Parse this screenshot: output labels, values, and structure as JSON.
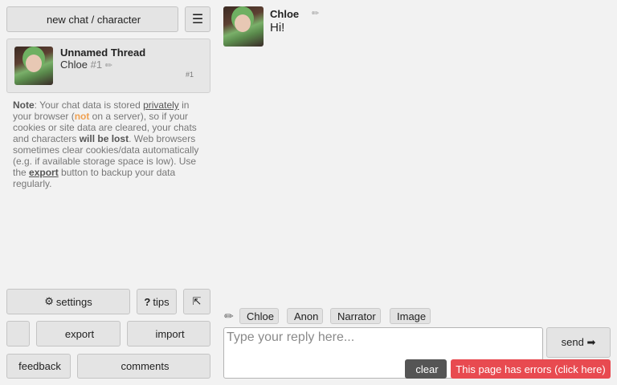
{
  "sidebar": {
    "new_chat_label": "new chat / character",
    "menu_icon": "☰",
    "thread": {
      "title": "Unnamed Thread",
      "character": "Chloe",
      "number": "#1",
      "badge": "#1"
    },
    "note": {
      "p1": "Note",
      "p2": ": Your chat data is stored ",
      "p3": "privately",
      "p4": " in your browser (",
      "p5": "not",
      "p6": " on a server), so if your cookies or site data are cleared, your chats and characters ",
      "p7": "will be lost",
      "p8": ". Web browsers sometimes clear cookies/data automatically ",
      "p9": " (e.g. if available storage space is low). Use the ",
      "p10": "export",
      "p11": " button to backup your data regularly."
    },
    "buttons": {
      "settings": "settings",
      "tips": "tips",
      "tips_icon": "?",
      "export": "export",
      "import": "import",
      "feedback": "feedback",
      "comments": "comments"
    }
  },
  "chat": {
    "message": {
      "name": "Chloe",
      "text": "Hi! "
    },
    "speakers": [
      "Chloe",
      "Anon",
      "Narrator",
      "Image"
    ],
    "input": {
      "placeholder": "Type your reply here...",
      "value": ""
    },
    "send_label": "send ➡",
    "clear_label": "clear",
    "error_label": "This page has errors (click here)"
  },
  "colors": {
    "error": "#e84a50",
    "warning": "#f0a050",
    "clear_button": "#555555"
  }
}
